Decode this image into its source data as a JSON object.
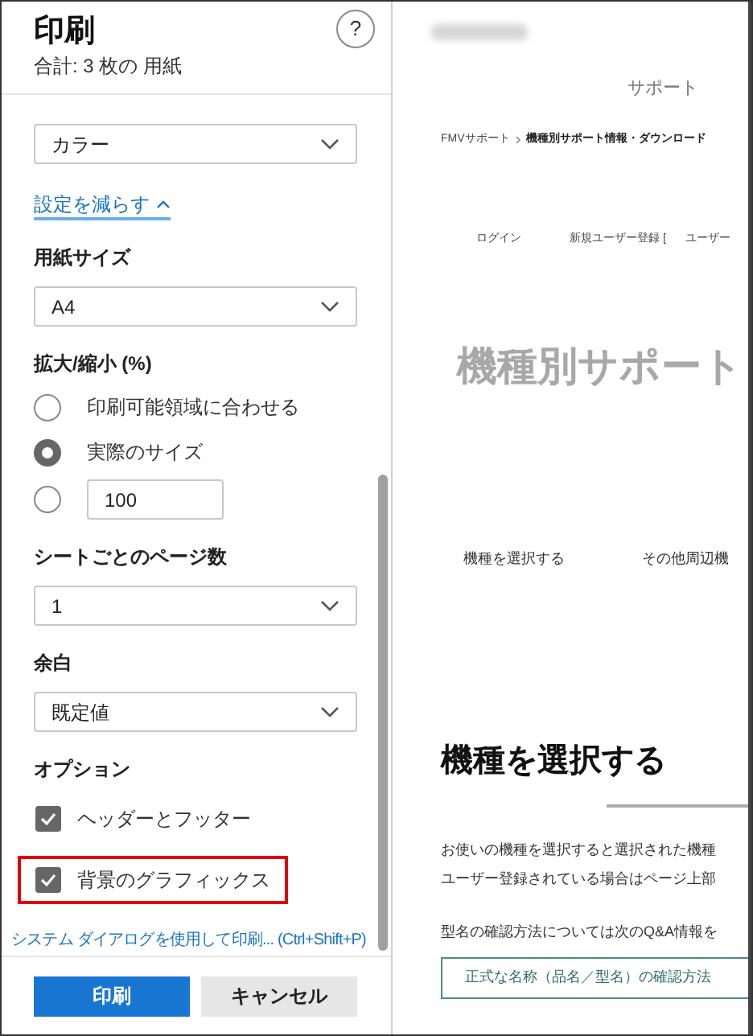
{
  "panel": {
    "title": "印刷",
    "subtitle": "合計: 3 枚の 用紙",
    "help": "?",
    "settings": [
      {
        "kind": "select",
        "value": "カラー"
      },
      {
        "kind": "link",
        "label": "設定を減らす"
      },
      {
        "kind": "heading",
        "text": "用紙サイズ"
      },
      {
        "kind": "select",
        "value": "A4"
      },
      {
        "kind": "heading",
        "text": "拡大/縮小 (%)"
      },
      {
        "kind": "radio",
        "label": "印刷可能領域に合わせる",
        "selected": false
      },
      {
        "kind": "radio",
        "label": "実際のサイズ",
        "selected": true
      },
      {
        "kind": "radio_input",
        "value": "100",
        "selected": false
      },
      {
        "kind": "heading",
        "text": "シートごとのページ数"
      },
      {
        "kind": "select",
        "value": "1"
      },
      {
        "kind": "heading",
        "text": "余白"
      },
      {
        "kind": "select",
        "value": "既定値"
      },
      {
        "kind": "heading",
        "text": "オプション"
      },
      {
        "kind": "checkbox",
        "label": "ヘッダーとフッター",
        "checked": true,
        "highlighted": false
      },
      {
        "kind": "checkbox",
        "label": "背景のグラフィックス",
        "checked": true,
        "highlighted": true
      },
      {
        "kind": "syslink",
        "label": "システム ダイアログを使用して印刷... (Ctrl+Shift+P)"
      }
    ],
    "buttons": [
      {
        "label": "印刷",
        "primary": true
      },
      {
        "label": "キャンセル",
        "primary": false
      }
    ]
  },
  "preview": {
    "site_label": "サポート",
    "breadcrumb": [
      "FMVサポート",
      "機種別サポート情報・ダウンロード"
    ],
    "nav": [
      "ログイン",
      "新規ユーザー登録 [",
      "ユーザー"
    ],
    "page_title": "機種別サポート",
    "tabs": [
      "機種を選択する",
      "その他周辺機"
    ],
    "heading": "機種を選択する",
    "paragraph_lines": [
      "お使いの機種を選択すると選択された機種",
      "ユーザー登録されている場合はページ上部"
    ],
    "note": "型名の確認方法については次のQ&A情報を",
    "link_button": "正式な名称（品名／型名）の確認方法"
  }
}
